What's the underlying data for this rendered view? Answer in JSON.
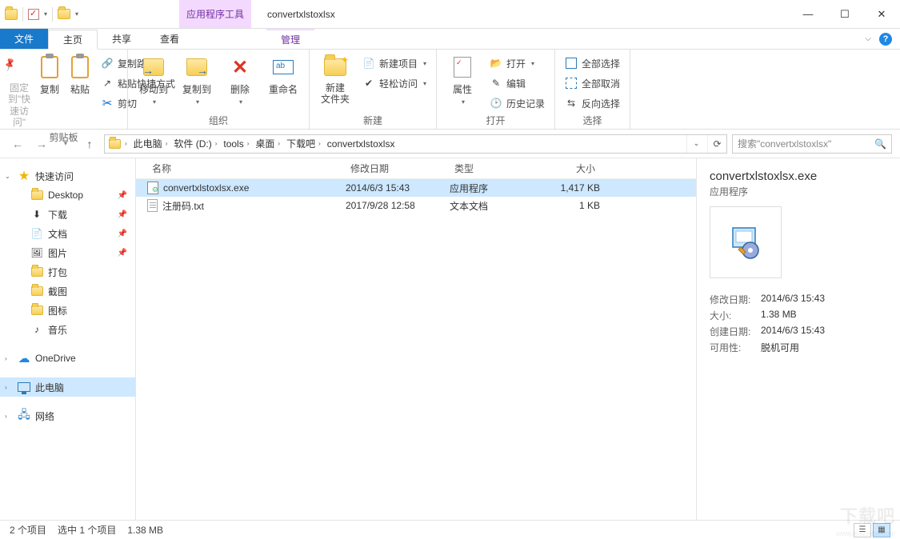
{
  "window": {
    "title": "convertxlstoxlsx",
    "tools_tab": "应用程序工具"
  },
  "tabs": {
    "file": "文件",
    "home": "主页",
    "share": "共享",
    "view": "查看",
    "manage": "管理"
  },
  "ribbon": {
    "pin": "固定到\"快\n速访问\"",
    "copy": "复制",
    "paste": "粘贴",
    "copy_path": "复制路径",
    "paste_shortcut": "粘贴快捷方式",
    "cut": "剪切",
    "group_clipboard": "剪贴板",
    "move_to": "移动到",
    "copy_to": "复制到",
    "delete": "删除",
    "rename": "重命名",
    "group_organize": "组织",
    "new_folder": "新建\n文件夹",
    "new_item": "新建项目",
    "easy_access": "轻松访问",
    "group_new": "新建",
    "properties": "属性",
    "open": "打开",
    "edit": "编辑",
    "history": "历史记录",
    "group_open": "打开",
    "select_all": "全部选择",
    "select_none": "全部取消",
    "invert": "反向选择",
    "group_select": "选择"
  },
  "breadcrumb": [
    "此电脑",
    "软件 (D:)",
    "tools",
    "桌面",
    "下载吧",
    "convertxlstoxlsx"
  ],
  "search_placeholder": "搜索\"convertxlstoxlsx\"",
  "columns": {
    "name": "名称",
    "date": "修改日期",
    "type": "类型",
    "size": "大小"
  },
  "files": [
    {
      "name": "convertxlstoxlsx.exe",
      "date": "2014/6/3 15:43",
      "type": "应用程序",
      "size": "1,417 KB",
      "selected": true,
      "icon": "exe"
    },
    {
      "name": "注册码.txt",
      "date": "2017/9/28 12:58",
      "type": "文本文档",
      "size": "1 KB",
      "selected": false,
      "icon": "txt"
    }
  ],
  "nav": {
    "quick_access": "快速访问",
    "items": [
      {
        "label": "Desktop",
        "icon": "folder",
        "pinned": true
      },
      {
        "label": "下载",
        "icon": "download",
        "pinned": true
      },
      {
        "label": "文档",
        "icon": "doc",
        "pinned": true
      },
      {
        "label": "图片",
        "icon": "pic",
        "pinned": true
      },
      {
        "label": "打包",
        "icon": "folder",
        "pinned": false
      },
      {
        "label": "截图",
        "icon": "folder",
        "pinned": false
      },
      {
        "label": "图标",
        "icon": "folder",
        "pinned": false
      },
      {
        "label": "音乐",
        "icon": "music",
        "pinned": false
      }
    ],
    "onedrive": "OneDrive",
    "this_pc": "此电脑",
    "network": "网络"
  },
  "details": {
    "title": "convertxlstoxlsx.exe",
    "subtitle": "应用程序",
    "rows": [
      {
        "k": "修改日期:",
        "v": "2014/6/3 15:43"
      },
      {
        "k": "大小:",
        "v": "1.38 MB"
      },
      {
        "k": "创建日期:",
        "v": "2014/6/3 15:43"
      },
      {
        "k": "可用性:",
        "v": "脱机可用"
      }
    ]
  },
  "status": {
    "count": "2 个项目",
    "selected": "选中 1 个项目",
    "size": "1.38 MB"
  },
  "watermark": "下载吧",
  "watermark_sub": "www.xiazaiba.com"
}
